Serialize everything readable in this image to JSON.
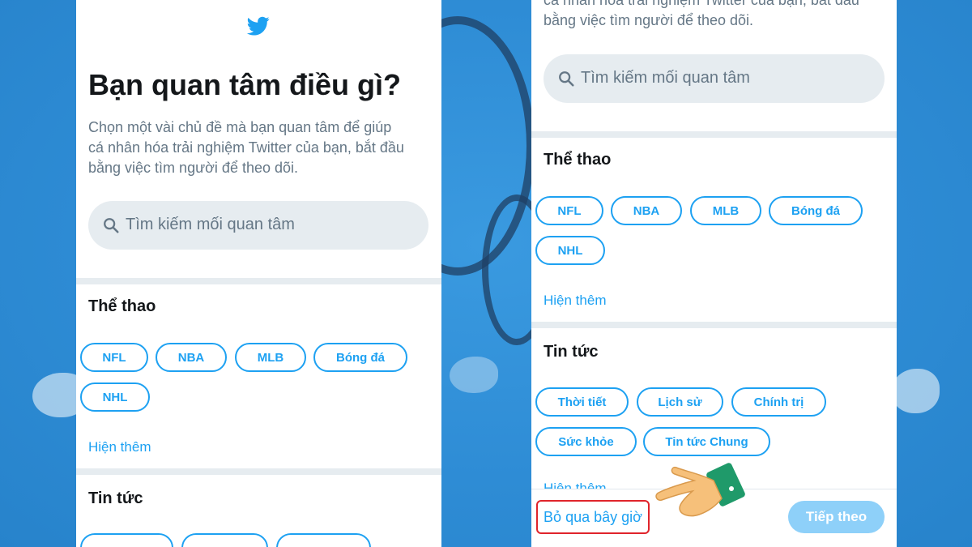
{
  "colors": {
    "accent": "#1da1f2",
    "background": "#2f8fd8",
    "text_primary": "#14171a",
    "text_secondary": "#657786",
    "highlight_border": "#e0242b"
  },
  "left_screen": {
    "logo_icon": "twitter-bird-icon",
    "heading": "Bạn quan tâm điều gì?",
    "description_lines": [
      "Chọn một vài chủ đề mà bạn quan tâm để giúp",
      "cá nhân hóa trải nghiệm Twitter của bạn, bắt đầu",
      "bằng việc tìm người để theo dõi."
    ],
    "search": {
      "icon": "search-icon",
      "placeholder": "Tìm kiếm mối quan tâm"
    },
    "sports": {
      "title": "Thể thao",
      "chips": [
        "NFL",
        "NBA",
        "MLB",
        "Bóng đá",
        "NHL"
      ],
      "show_more": "Hiện thêm"
    },
    "news": {
      "title": "Tin tức"
    }
  },
  "right_screen": {
    "top_partial_lines": [
      "cá nhân hóa trải nghiệm Twitter của bạn, bắt đầu",
      "bằng việc tìm người để theo dõi."
    ],
    "search": {
      "icon": "search-icon",
      "placeholder": "Tìm kiếm mối quan tâm"
    },
    "sports": {
      "title": "Thể thao",
      "chips": [
        "NFL",
        "NBA",
        "MLB",
        "Bóng đá",
        "NHL"
      ],
      "show_more": "Hiện thêm"
    },
    "news": {
      "title": "Tin tức",
      "chips": [
        "Thời tiết",
        "Lịch sử",
        "Chính trị",
        "Sức khỏe",
        "Tin tức Chung"
      ]
    },
    "footer": {
      "skip_label": "Bỏ qua bây giờ",
      "next_label": "Tiếp theo"
    },
    "pointer_icon": "pointing-hand-icon"
  }
}
